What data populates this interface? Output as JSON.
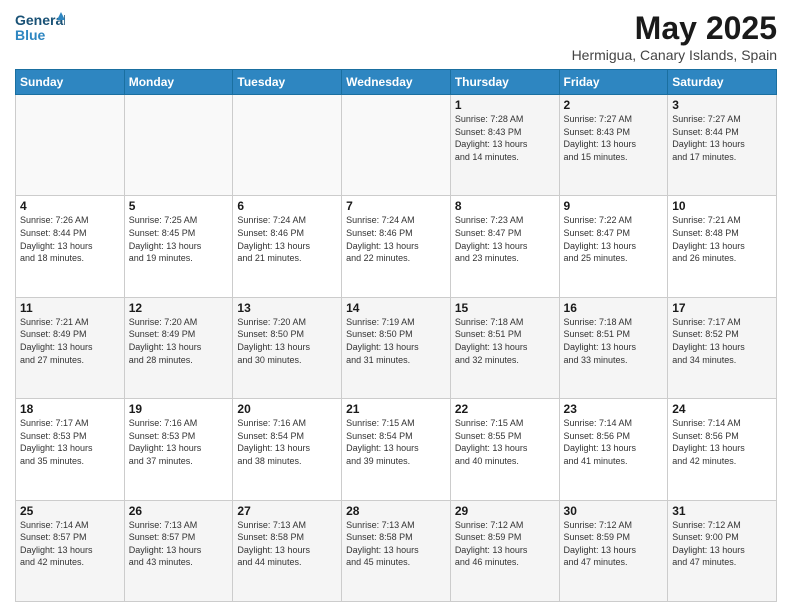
{
  "header": {
    "logo_line1": "General",
    "logo_line2": "Blue",
    "title": "May 2025",
    "subtitle": "Hermigua, Canary Islands, Spain"
  },
  "days_of_week": [
    "Sunday",
    "Monday",
    "Tuesday",
    "Wednesday",
    "Thursday",
    "Friday",
    "Saturday"
  ],
  "weeks": [
    [
      {
        "day": "",
        "info": ""
      },
      {
        "day": "",
        "info": ""
      },
      {
        "day": "",
        "info": ""
      },
      {
        "day": "",
        "info": ""
      },
      {
        "day": "1",
        "info": "Sunrise: 7:28 AM\nSunset: 8:43 PM\nDaylight: 13 hours\nand 14 minutes."
      },
      {
        "day": "2",
        "info": "Sunrise: 7:27 AM\nSunset: 8:43 PM\nDaylight: 13 hours\nand 15 minutes."
      },
      {
        "day": "3",
        "info": "Sunrise: 7:27 AM\nSunset: 8:44 PM\nDaylight: 13 hours\nand 17 minutes."
      }
    ],
    [
      {
        "day": "4",
        "info": "Sunrise: 7:26 AM\nSunset: 8:44 PM\nDaylight: 13 hours\nand 18 minutes."
      },
      {
        "day": "5",
        "info": "Sunrise: 7:25 AM\nSunset: 8:45 PM\nDaylight: 13 hours\nand 19 minutes."
      },
      {
        "day": "6",
        "info": "Sunrise: 7:24 AM\nSunset: 8:46 PM\nDaylight: 13 hours\nand 21 minutes."
      },
      {
        "day": "7",
        "info": "Sunrise: 7:24 AM\nSunset: 8:46 PM\nDaylight: 13 hours\nand 22 minutes."
      },
      {
        "day": "8",
        "info": "Sunrise: 7:23 AM\nSunset: 8:47 PM\nDaylight: 13 hours\nand 23 minutes."
      },
      {
        "day": "9",
        "info": "Sunrise: 7:22 AM\nSunset: 8:47 PM\nDaylight: 13 hours\nand 25 minutes."
      },
      {
        "day": "10",
        "info": "Sunrise: 7:21 AM\nSunset: 8:48 PM\nDaylight: 13 hours\nand 26 minutes."
      }
    ],
    [
      {
        "day": "11",
        "info": "Sunrise: 7:21 AM\nSunset: 8:49 PM\nDaylight: 13 hours\nand 27 minutes."
      },
      {
        "day": "12",
        "info": "Sunrise: 7:20 AM\nSunset: 8:49 PM\nDaylight: 13 hours\nand 28 minutes."
      },
      {
        "day": "13",
        "info": "Sunrise: 7:20 AM\nSunset: 8:50 PM\nDaylight: 13 hours\nand 30 minutes."
      },
      {
        "day": "14",
        "info": "Sunrise: 7:19 AM\nSunset: 8:50 PM\nDaylight: 13 hours\nand 31 minutes."
      },
      {
        "day": "15",
        "info": "Sunrise: 7:18 AM\nSunset: 8:51 PM\nDaylight: 13 hours\nand 32 minutes."
      },
      {
        "day": "16",
        "info": "Sunrise: 7:18 AM\nSunset: 8:51 PM\nDaylight: 13 hours\nand 33 minutes."
      },
      {
        "day": "17",
        "info": "Sunrise: 7:17 AM\nSunset: 8:52 PM\nDaylight: 13 hours\nand 34 minutes."
      }
    ],
    [
      {
        "day": "18",
        "info": "Sunrise: 7:17 AM\nSunset: 8:53 PM\nDaylight: 13 hours\nand 35 minutes."
      },
      {
        "day": "19",
        "info": "Sunrise: 7:16 AM\nSunset: 8:53 PM\nDaylight: 13 hours\nand 37 minutes."
      },
      {
        "day": "20",
        "info": "Sunrise: 7:16 AM\nSunset: 8:54 PM\nDaylight: 13 hours\nand 38 minutes."
      },
      {
        "day": "21",
        "info": "Sunrise: 7:15 AM\nSunset: 8:54 PM\nDaylight: 13 hours\nand 39 minutes."
      },
      {
        "day": "22",
        "info": "Sunrise: 7:15 AM\nSunset: 8:55 PM\nDaylight: 13 hours\nand 40 minutes."
      },
      {
        "day": "23",
        "info": "Sunrise: 7:14 AM\nSunset: 8:56 PM\nDaylight: 13 hours\nand 41 minutes."
      },
      {
        "day": "24",
        "info": "Sunrise: 7:14 AM\nSunset: 8:56 PM\nDaylight: 13 hours\nand 42 minutes."
      }
    ],
    [
      {
        "day": "25",
        "info": "Sunrise: 7:14 AM\nSunset: 8:57 PM\nDaylight: 13 hours\nand 42 minutes."
      },
      {
        "day": "26",
        "info": "Sunrise: 7:13 AM\nSunset: 8:57 PM\nDaylight: 13 hours\nand 43 minutes."
      },
      {
        "day": "27",
        "info": "Sunrise: 7:13 AM\nSunset: 8:58 PM\nDaylight: 13 hours\nand 44 minutes."
      },
      {
        "day": "28",
        "info": "Sunrise: 7:13 AM\nSunset: 8:58 PM\nDaylight: 13 hours\nand 45 minutes."
      },
      {
        "day": "29",
        "info": "Sunrise: 7:12 AM\nSunset: 8:59 PM\nDaylight: 13 hours\nand 46 minutes."
      },
      {
        "day": "30",
        "info": "Sunrise: 7:12 AM\nSunset: 8:59 PM\nDaylight: 13 hours\nand 47 minutes."
      },
      {
        "day": "31",
        "info": "Sunrise: 7:12 AM\nSunset: 9:00 PM\nDaylight: 13 hours\nand 47 minutes."
      }
    ]
  ]
}
